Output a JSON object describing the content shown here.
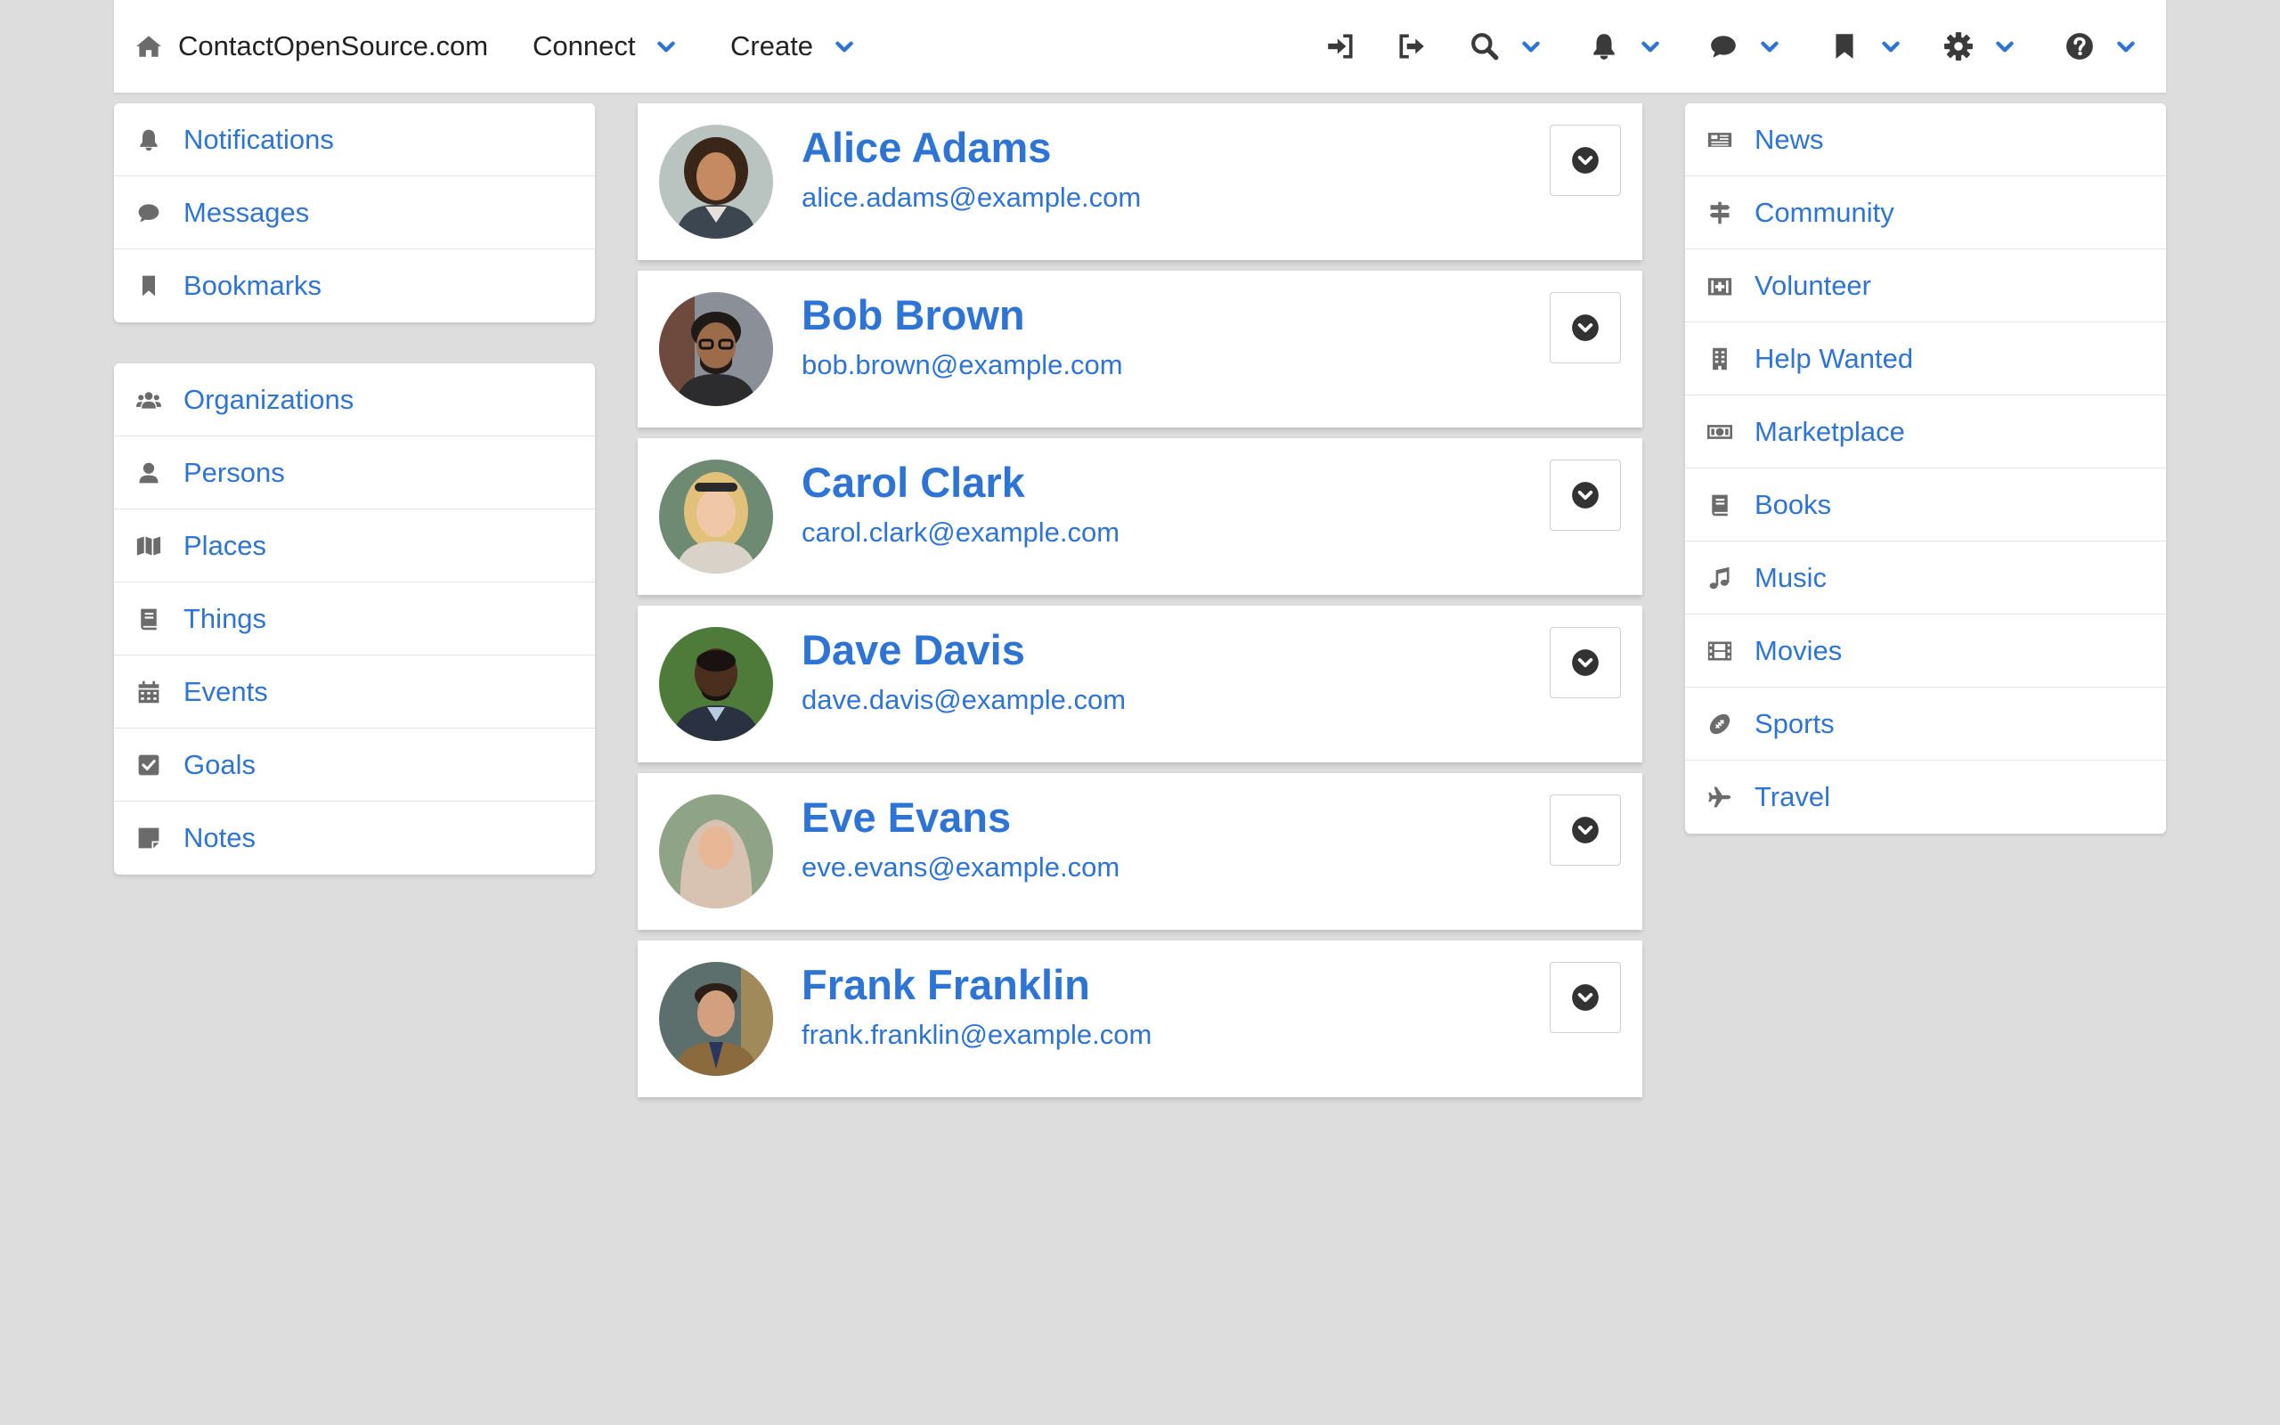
{
  "navbar": {
    "brand": "ContactOpenSource.com",
    "menus": [
      "Connect",
      "Create"
    ],
    "icons": [
      "sign-in-icon",
      "sign-out-icon",
      "search-icon",
      "bell-icon",
      "comment-icon",
      "bookmark-icon",
      "gear-icon",
      "help-icon"
    ]
  },
  "left_top": {
    "items": [
      {
        "label": "Notifications",
        "icon": "bell-icon"
      },
      {
        "label": "Messages",
        "icon": "comment-icon"
      },
      {
        "label": "Bookmarks",
        "icon": "bookmark-icon"
      }
    ]
  },
  "left_bottom": {
    "items": [
      {
        "label": "Organizations",
        "icon": "users-icon"
      },
      {
        "label": "Persons",
        "icon": "user-icon"
      },
      {
        "label": "Places",
        "icon": "map-icon"
      },
      {
        "label": "Things",
        "icon": "book-icon"
      },
      {
        "label": "Events",
        "icon": "calendar-icon"
      },
      {
        "label": "Goals",
        "icon": "check-square-icon"
      },
      {
        "label": "Notes",
        "icon": "sticky-note-icon"
      }
    ]
  },
  "right": {
    "items": [
      {
        "label": "News",
        "icon": "newspaper-icon"
      },
      {
        "label": "Community",
        "icon": "signs-icon"
      },
      {
        "label": "Volunteer",
        "icon": "medkit-icon"
      },
      {
        "label": "Help Wanted",
        "icon": "building-icon"
      },
      {
        "label": "Marketplace",
        "icon": "money-icon"
      },
      {
        "label": "Books",
        "icon": "book-icon"
      },
      {
        "label": "Music",
        "icon": "music-icon"
      },
      {
        "label": "Movies",
        "icon": "film-icon"
      },
      {
        "label": "Sports",
        "icon": "football-icon"
      },
      {
        "label": "Travel",
        "icon": "plane-icon"
      }
    ]
  },
  "persons": [
    {
      "name": "Alice Adams",
      "email": "alice.adams@example.com"
    },
    {
      "name": "Bob Brown",
      "email": "bob.brown@example.com"
    },
    {
      "name": "Carol Clark",
      "email": "carol.clark@example.com"
    },
    {
      "name": "Dave Davis",
      "email": "dave.davis@example.com"
    },
    {
      "name": "Eve Evans",
      "email": "eve.evans@example.com"
    },
    {
      "name": "Frank Franklin",
      "email": "frank.franklin@example.com"
    }
  ],
  "colors": {
    "accent": "#2e74d4",
    "background": "#dddddd",
    "panel": "#ffffff"
  }
}
